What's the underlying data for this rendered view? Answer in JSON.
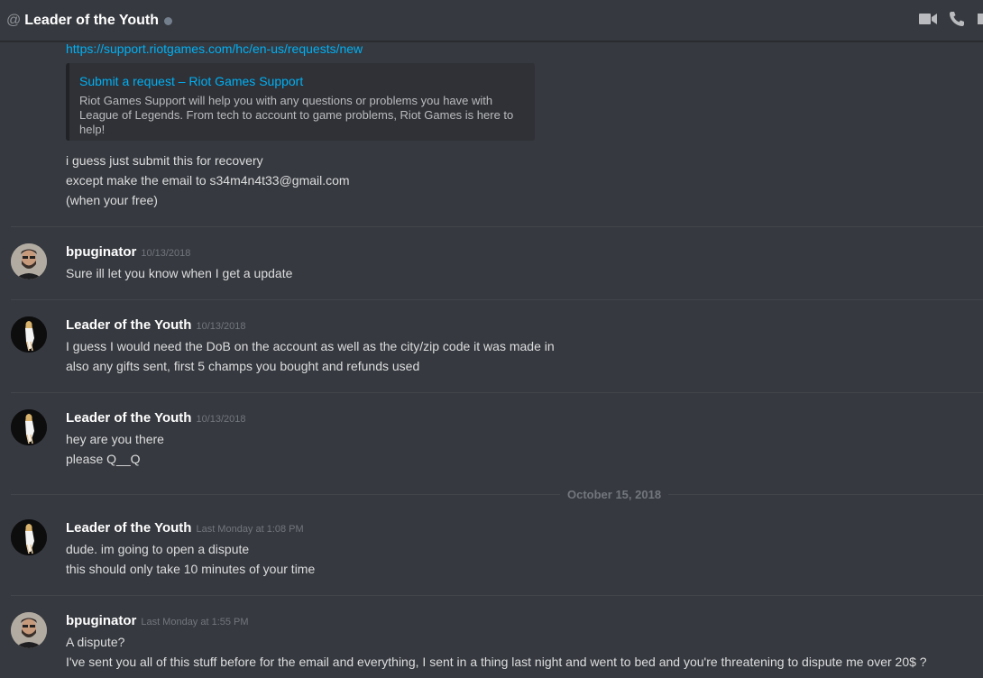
{
  "header": {
    "at_symbol": "@",
    "title": "Leader of the Youth",
    "icons": [
      "video-call-icon",
      "voice-call-icon"
    ]
  },
  "top_message": {
    "link": "https://support.riotgames.com/hc/en-us/requests/new",
    "embed": {
      "title": "Submit a request – Riot Games Support",
      "description": "Riot Games Support will help you with any questions or problems you have with League of Legends. From tech to account to game problems, Riot Games is here to help!"
    },
    "lines": [
      "i guess just submit this for recovery",
      "except make the email to s34m4n4t33@gmail.com",
      "(when your free)"
    ]
  },
  "messages": [
    {
      "author": "bpuginator",
      "timestamp": "10/13/2018",
      "lines": [
        "Sure ill let you know when I get a update"
      ]
    },
    {
      "author": "Leader of the Youth",
      "timestamp": "10/13/2018",
      "lines": [
        "I guess I would need the DoB on the account as well as the city/zip code it was made in",
        "also any gifts sent, first 5 champs you bought and refunds used"
      ]
    },
    {
      "author": "Leader of the Youth",
      "timestamp": "10/13/2018",
      "lines": [
        "hey are you there",
        "please Q__Q"
      ]
    },
    {
      "author": "Leader of the Youth",
      "timestamp": "Last Monday at 1:08 PM",
      "lines": [
        "dude. im going to open a dispute",
        "this should only take 10 minutes of your time"
      ]
    },
    {
      "author": "bpuginator",
      "timestamp": "Last Monday at 1:55 PM",
      "lines": [
        "A dispute?",
        "I've sent you all of this stuff before for the email and everything, I sent in a thing last night and went to bed and you're threatening to dispute me over 20$ ?"
      ]
    }
  ],
  "date_separator": "October 15, 2018"
}
